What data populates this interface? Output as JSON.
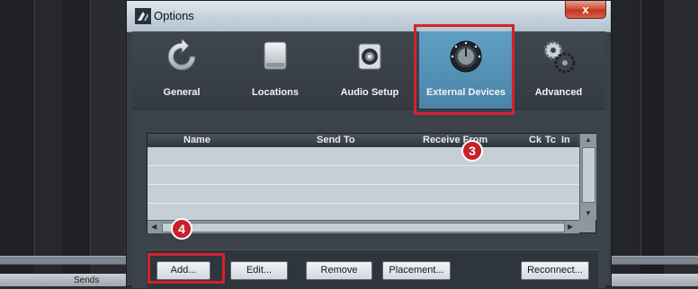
{
  "window": {
    "title": "Options",
    "close_label": "x"
  },
  "toolbar": {
    "items": [
      {
        "label": "General"
      },
      {
        "label": "Locations"
      },
      {
        "label": "Audio Setup"
      },
      {
        "label": "External Devices",
        "selected": true
      },
      {
        "label": "Advanced"
      }
    ]
  },
  "device_list": {
    "columns": [
      "Name",
      "Send To",
      "Receive From",
      "Ck",
      "Tc",
      "In"
    ],
    "rows": []
  },
  "buttons": {
    "add": "Add...",
    "edit": "Edit...",
    "remove": "Remove",
    "placement": "Placement...",
    "reconnect": "Reconnect..."
  },
  "annotations": {
    "step3": "3",
    "step4": "4"
  },
  "background": {
    "sends_label": "Sends"
  },
  "colors": {
    "selected_tab": "#5f9fc3",
    "annotation": "#d4222c"
  }
}
